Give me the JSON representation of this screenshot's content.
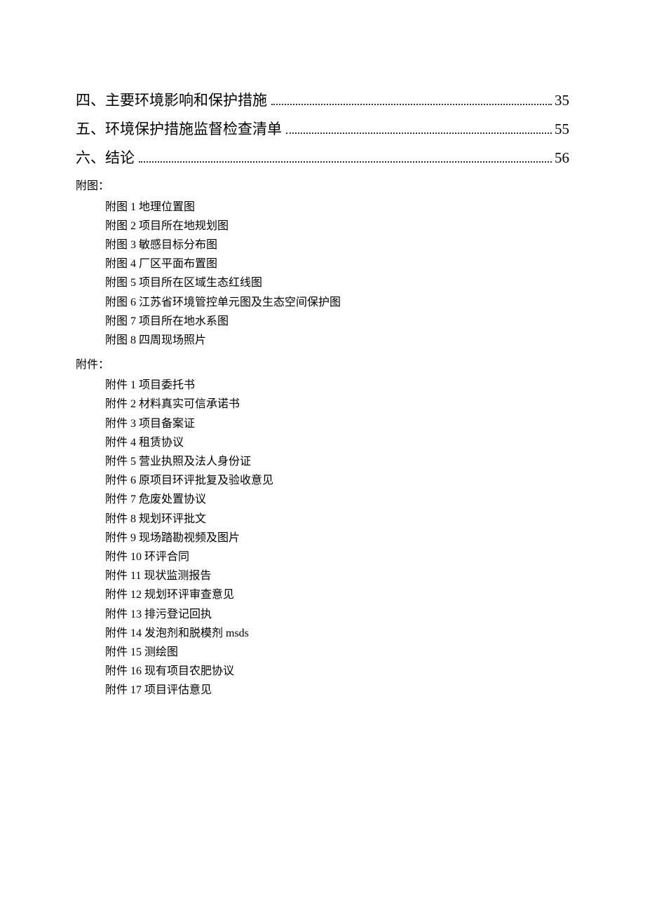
{
  "toc": [
    {
      "title": "四、主要环境影响和保护措施",
      "page": "35"
    },
    {
      "title": "五、环境保护措施监督检查清单",
      "page": "55"
    },
    {
      "title": "六、结论",
      "page": "56"
    }
  ],
  "sections": [
    {
      "label": "附图：",
      "items": [
        "附图 1 地理位置图",
        "附图 2 项目所在地规划图",
        "附图 3 敏感目标分布图",
        "附图 4 厂区平面布置图",
        "附图 5 项目所在区域生态红线图",
        "附图 6 江苏省环境管控单元图及生态空间保护图",
        "附图 7 项目所在地水系图",
        "附图 8 四周现场照片"
      ]
    },
    {
      "label": "附件：",
      "items": [
        "附件 1 项目委托书",
        "附件 2 材料真实可信承诺书",
        "附件 3 项目备案证",
        "附件 4 租赁协议",
        "附件 5 营业执照及法人身份证",
        "附件 6 原项目环评批复及验收意见",
        "附件 7 危废处置协议",
        "附件 8 规划环评批文",
        "附件 9 现场踏勘视频及图片",
        "附件 10 环评合同",
        "附件 11 现状监测报告",
        "附件 12 规划环评审查意见",
        "附件 13 排污登记回执",
        "附件 14 发泡剂和脱模剂 msds",
        "附件 15 测绘图",
        "附件 16 现有项目农肥协议",
        "附件 17 项目评估意见"
      ]
    }
  ]
}
